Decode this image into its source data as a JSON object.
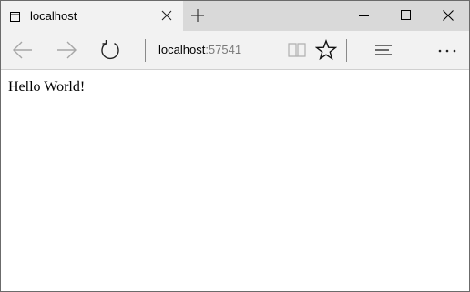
{
  "tab": {
    "title": "localhost",
    "icon": "page-icon"
  },
  "window_controls": {
    "minimize_icon": "minimize-icon",
    "maximize_icon": "maximize-icon",
    "close_icon": "close-icon"
  },
  "toolbar": {
    "back_icon": "back-arrow-icon",
    "forward_icon": "forward-arrow-icon",
    "refresh_icon": "refresh-icon",
    "address_host": "localhost",
    "address_port": ":57541",
    "reading_view_icon": "book-icon",
    "favorites_icon": "star-icon",
    "hub_icon": "hub-lines-icon",
    "more_icon": "more-dots-icon"
  },
  "page": {
    "content": "Hello World!"
  },
  "colors": {
    "tab_strip": "#d9d9d9",
    "active_tab": "#f2f2f2",
    "toolbar": "#f2f2f2",
    "port_text": "#7a7a7a"
  }
}
